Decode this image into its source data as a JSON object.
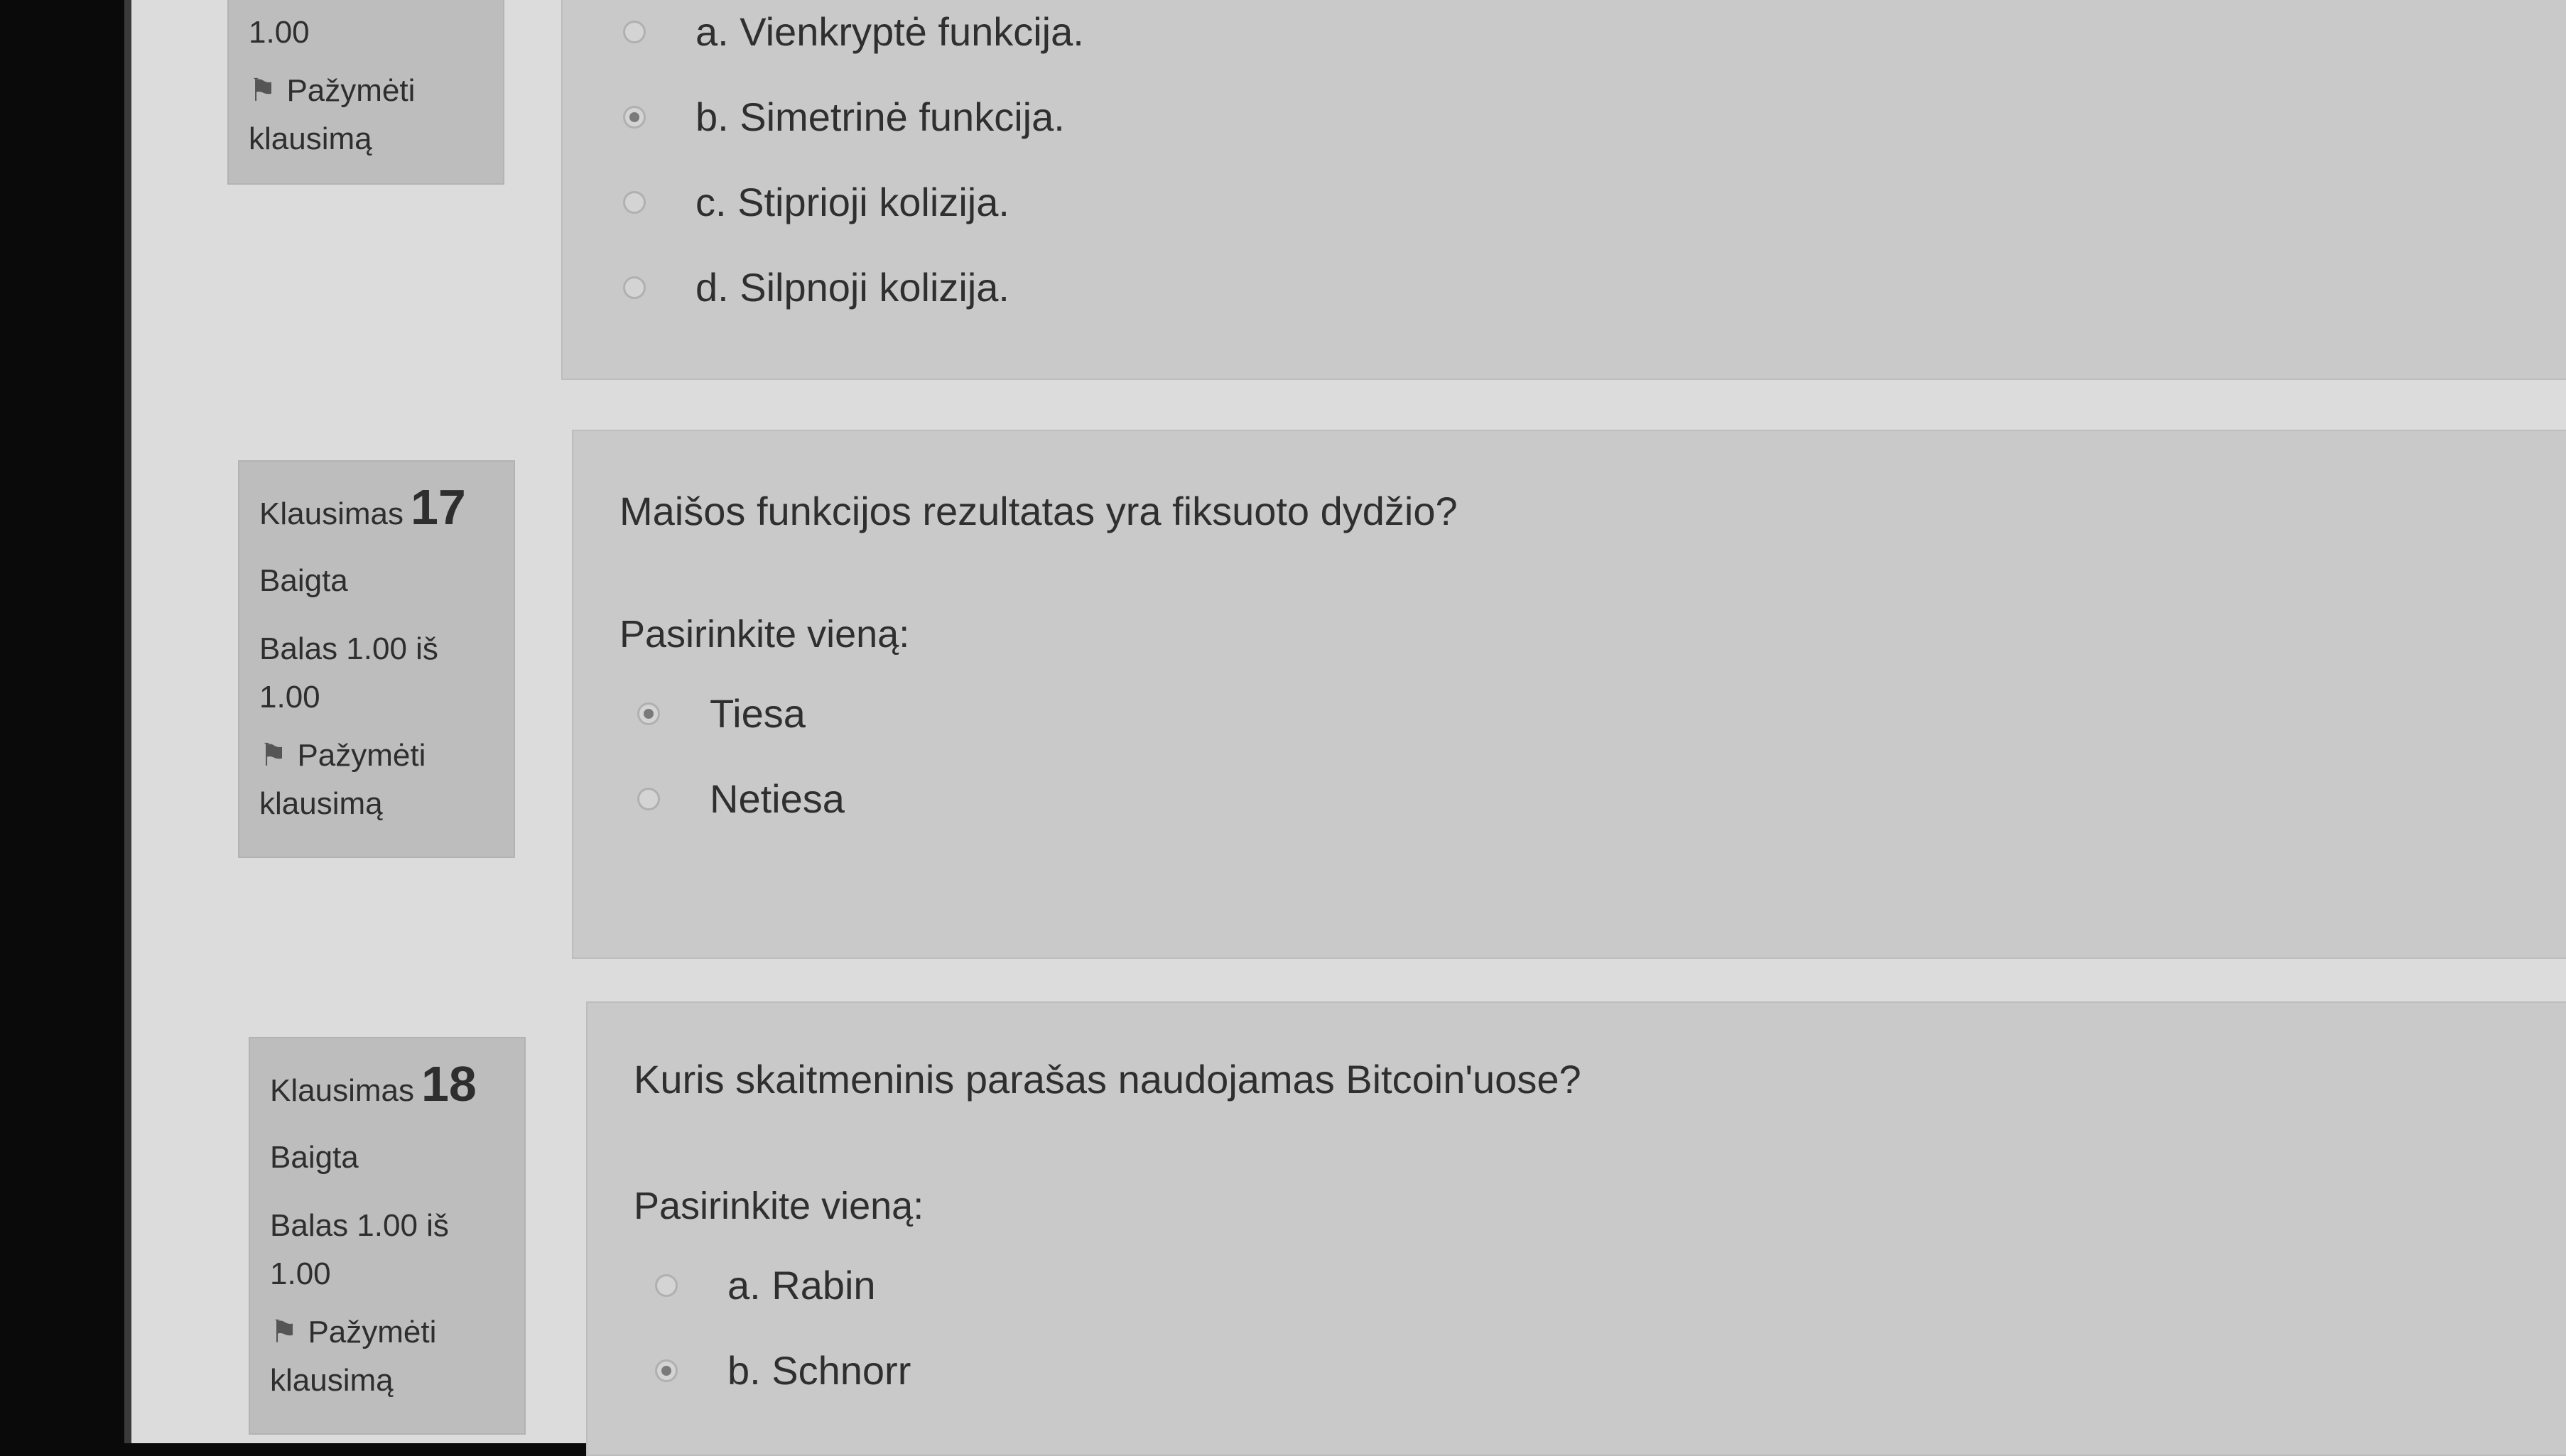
{
  "questions": [
    {
      "number": "",
      "status": "",
      "score": "1.00",
      "flag_label": "Pažymėti klausimą",
      "text": "",
      "prompt": "",
      "options": [
        {
          "label": "a. Vienkryptė funkcija.",
          "selected": false
        },
        {
          "label": "b. Simetrinė funkcija.",
          "selected": true
        },
        {
          "label": "c. Stiprioji kolizija.",
          "selected": false
        },
        {
          "label": "d. Silpnoji kolizija.",
          "selected": false
        }
      ]
    },
    {
      "title": "Klausimas",
      "number": "17",
      "status": "Baigta",
      "score_line1": "Balas 1.00 iš",
      "score_line2": "1.00",
      "flag_line1": "Pažymėti",
      "flag_line2": "klausimą",
      "text": "Maišos funkcijos rezultatas yra fiksuoto dydžio?",
      "prompt": "Pasirinkite vieną:",
      "options": [
        {
          "label": "Tiesa",
          "selected": true
        },
        {
          "label": "Netiesa",
          "selected": false
        }
      ]
    },
    {
      "title": "Klausimas",
      "number": "18",
      "status": "Baigta",
      "score_line1": "Balas 1.00 iš",
      "score_line2": "1.00",
      "flag_line1": "Pažymėti",
      "flag_line2": "klausimą",
      "text": "Kuris skaitmeninis parašas naudojamas Bitcoin'uose?",
      "prompt": "Pasirinkite vieną:",
      "options": [
        {
          "label": "a. Rabin",
          "selected": false
        },
        {
          "label": "b. Schnorr",
          "selected": true
        }
      ]
    }
  ],
  "q16_flag_line1": "Pažymėti",
  "q16_flag_line2": "klausimą"
}
